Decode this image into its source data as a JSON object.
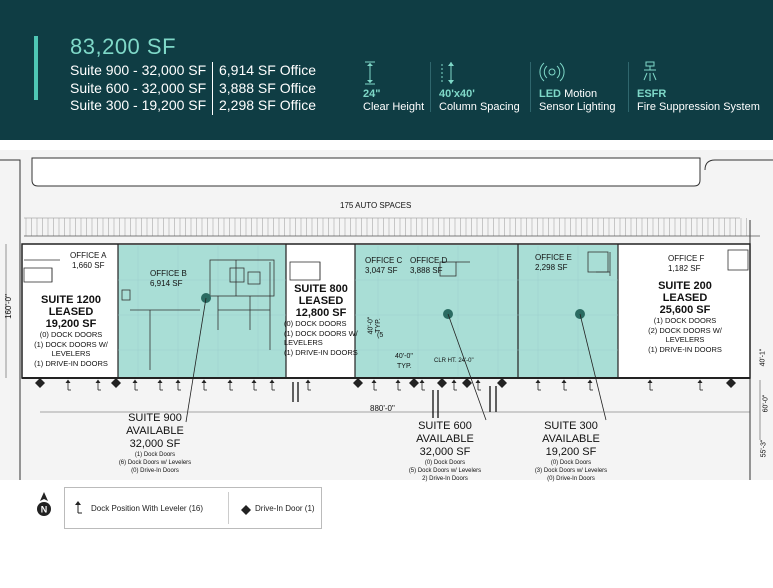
{
  "header": {
    "total_sf": "83,200 SF",
    "suites": [
      {
        "name": "Suite 900 - 32,000 SF",
        "office": "6,914 SF Office"
      },
      {
        "name": "Suite 600 - 32,000 SF",
        "office": "3,888 SF Office"
      },
      {
        "name": "Suite 300 - 19,200 SF",
        "office": "2,298 SF Office"
      }
    ],
    "features": [
      {
        "icon": "clear-height-icon",
        "highlight": "24\"",
        "text": "Clear Height"
      },
      {
        "icon": "column-spacing-icon",
        "highlight": "40'x40'",
        "text": "Column Spacing"
      },
      {
        "icon": "motion-sensor-icon",
        "highlight": "LED",
        "text": "Motion",
        "text2": "Sensor Lighting"
      },
      {
        "icon": "sprinkler-icon",
        "highlight": "ESFR",
        "text": "Fire Suppression System"
      }
    ],
    "colors": {
      "background": "#0f3d44",
      "accent": "#7fd8c8",
      "available_fill": "#a9ded6"
    }
  },
  "plan": {
    "parking": "175 AUTO SPACES",
    "building_depth": "160'-0\"",
    "building_length": "880'-0\"",
    "truck_court": "60'-0\"",
    "parking_depth": "55'-3\"",
    "setback": "40'-1\"",
    "column_y": "40'-0\"",
    "column_y_typ": "TYP.",
    "column_x": "40'-0\"",
    "column_x_typ": "TYP.",
    "clear_height": "CLR HT. 24'-0\"",
    "dim_5": "(5",
    "offices": [
      {
        "name": "OFFICE A",
        "sf": "1,660 SF"
      },
      {
        "name": "OFFICE B",
        "sf": "6,914 SF"
      },
      {
        "name": "OFFICE C",
        "sf": "3,047 SF"
      },
      {
        "name": "OFFICE D",
        "sf": "3,888 SF"
      },
      {
        "name": "OFFICE E",
        "sf": "2,298 SF"
      },
      {
        "name": "OFFICE F",
        "sf": "1,182 SF"
      }
    ],
    "leased": [
      {
        "suite": "SUITE 1200",
        "status": "LEASED",
        "sf": "19,200 SF",
        "l1": "(0) DOCK DOORS",
        "l2": "(1) DOCK DOORS W/",
        "l3": "LEVELERS",
        "l4": "(1) DRIVE-IN DOORS"
      },
      {
        "suite": "SUITE 800",
        "status": "LEASED",
        "sf": "12,800 SF",
        "l1": "(0) DOCK DOORS",
        "l2": "(1) DOCK DOORS W/",
        "l3": "LEVELERS",
        "l4": "(1) DRIVE-IN DOORS"
      },
      {
        "suite": "SUITE 200",
        "status": "LEASED",
        "sf": "25,600 SF",
        "l1": "(1) DOCK DOORS",
        "l2": "(2) DOCK DOORS W/",
        "l3": "LEVELERS",
        "l4": "(1) DRIVE-IN DOORS"
      }
    ],
    "available": [
      {
        "suite": "SUITE 900",
        "status": "AVAILABLE",
        "sf": "32,000 SF",
        "l1": "(1) Dock Doors",
        "l2": "(6) Dock Doors w/ Levelers",
        "l3": "(0) Drive-In Doors"
      },
      {
        "suite": "SUITE 600",
        "status": "AVAILABLE",
        "sf": "32,000 SF",
        "l1": "(0) Dock Doors",
        "l2": "(5) Dock Doors w/ Levelers",
        "l3": "2) Drive-In Doors"
      },
      {
        "suite": "SUITE 300",
        "status": "AVAILABLE",
        "sf": "19,200 SF",
        "l1": "(0) Dock Doors",
        "l2": "(3) Dock Doors w/ Levelers",
        "l3": "(0) Drive-In Doors"
      }
    ]
  },
  "legend": {
    "dock": "Dock Position With Leveler (16)",
    "drive": "Drive-In Door (1)",
    "north": "N"
  }
}
